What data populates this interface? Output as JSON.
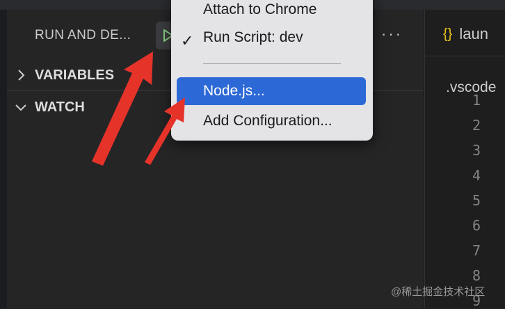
{
  "sidebar": {
    "title": "RUN AND DE...",
    "run_icon": "play-icon",
    "more_label": "···",
    "sections": [
      {
        "label": "VARIABLES",
        "icon": "chevron-right-icon"
      },
      {
        "label": "WATCH",
        "icon": "chevron-down-icon"
      }
    ]
  },
  "menu": {
    "items": [
      {
        "label": "Attach to Chrome",
        "checked": false,
        "highlighted": false
      },
      {
        "label": "Run Script: dev",
        "checked": true,
        "highlighted": false
      },
      {
        "label": "Node.js...",
        "checked": false,
        "highlighted": true
      },
      {
        "label": "Add Configuration...",
        "checked": false,
        "highlighted": false
      }
    ],
    "separator": "———————————",
    "checkmark": "✓"
  },
  "editor": {
    "tab": {
      "icon": "braces-icon",
      "icon_text": "{}",
      "name": "laun"
    },
    "breadcrumb": ".vscode",
    "line_numbers": [
      "1",
      "2",
      "3",
      "4",
      "5",
      "6",
      "7",
      "8",
      "9"
    ]
  },
  "annotations": {
    "arrow_color": "#e6332a"
  },
  "colors": {
    "highlight": "#2d69d6",
    "menu_bg": "#e4e3e6",
    "accent_play": "#89d185"
  },
  "watermark": "@稀土掘金技术社区"
}
